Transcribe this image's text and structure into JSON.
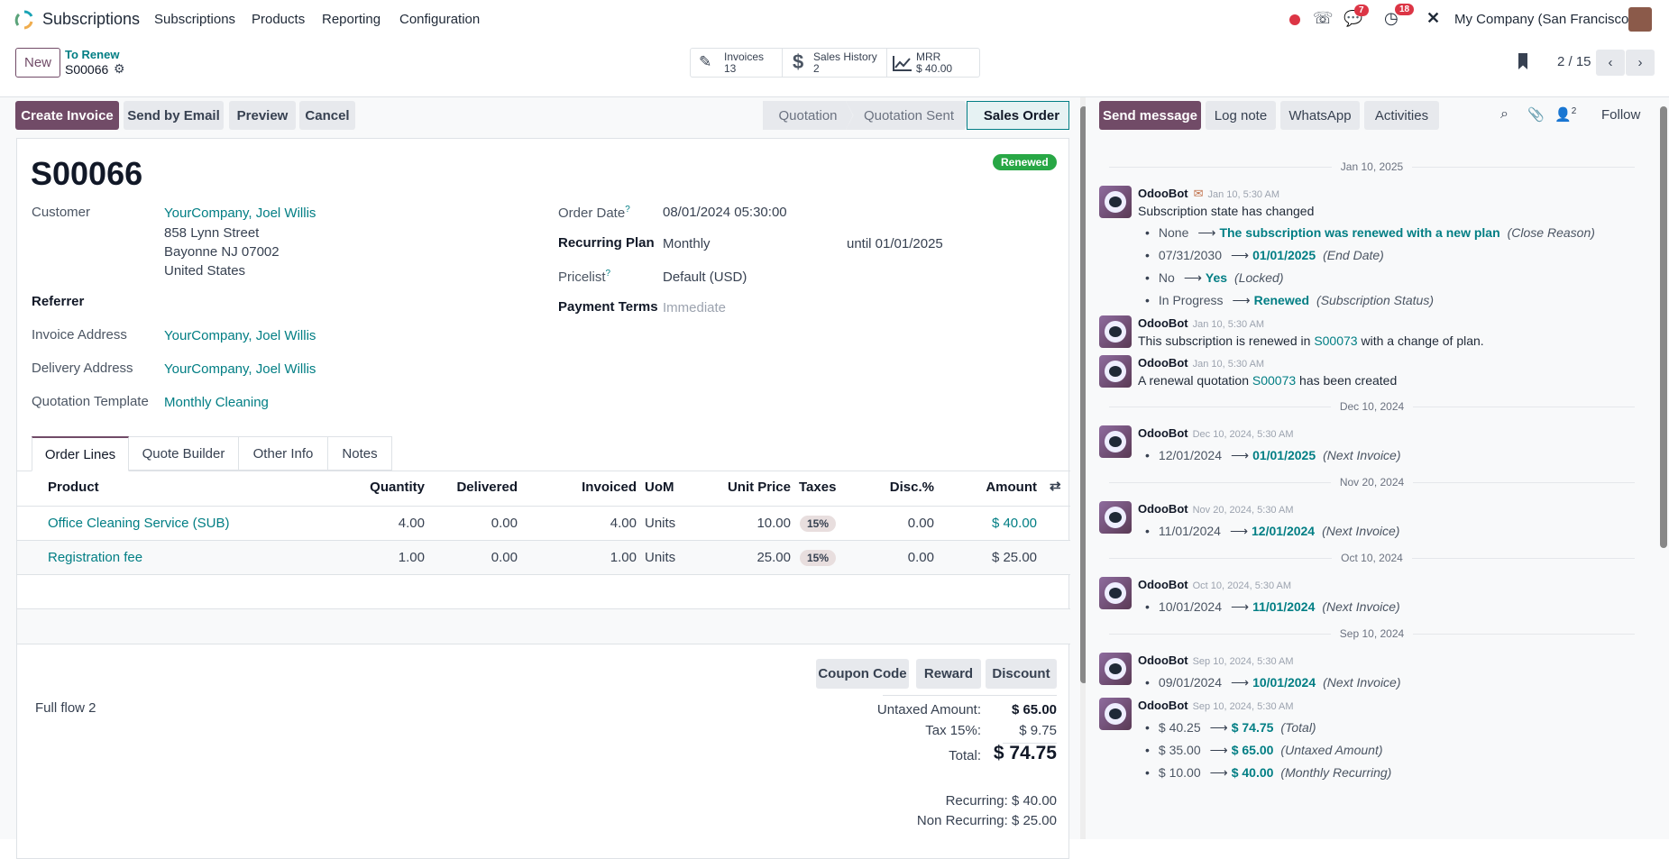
{
  "nav": {
    "app": "Subscriptions",
    "menu": [
      "Subscriptions",
      "Products",
      "Reporting",
      "Configuration"
    ],
    "chat_count": "7",
    "activity_count": "18",
    "company": "My Company (San Francisco)"
  },
  "control": {
    "new": "New",
    "breadcrumb": "To Renew",
    "record": "S00066",
    "stats": [
      {
        "label": "Invoices",
        "value": "13"
      },
      {
        "label": "Sales History",
        "value": "2"
      },
      {
        "label": "MRR",
        "value": "$ 40.00"
      }
    ],
    "pager": "2 / 15"
  },
  "actions": {
    "create_invoice": "Create Invoice",
    "send_email": "Send by Email",
    "preview": "Preview",
    "cancel": "Cancel"
  },
  "statusbar": {
    "stages": [
      "Quotation",
      "Quotation Sent",
      "Sales Order"
    ],
    "active": "Sales Order"
  },
  "form": {
    "name": "S00066",
    "ribbon": "Renewed",
    "customer_label": "Customer",
    "customer": "YourCompany, Joel Willis",
    "address": [
      "858 Lynn Street",
      "Bayonne NJ 07002",
      "United States"
    ],
    "referrer_label": "Referrer",
    "invoice_address_label": "Invoice Address",
    "invoice_address": "YourCompany, Joel Willis",
    "delivery_address_label": "Delivery Address",
    "delivery_address": "YourCompany, Joel Willis",
    "template_label": "Quotation Template",
    "template": "Monthly Cleaning",
    "order_date_label": "Order Date",
    "order_date": "08/01/2024 05:30:00",
    "help": "?",
    "plan_label": "Recurring Plan",
    "plan": "Monthly",
    "until": "until 01/01/2025",
    "pricelist_label": "Pricelist",
    "pricelist": "Default (USD)",
    "terms_label": "Payment Terms",
    "terms": "Immediate"
  },
  "tabs": [
    "Order Lines",
    "Quote Builder",
    "Other Info",
    "Notes"
  ],
  "table": {
    "headers": [
      "Product",
      "Quantity",
      "Delivered",
      "Invoiced",
      "UoM",
      "Unit Price",
      "Taxes",
      "Disc.%",
      "Amount"
    ],
    "rows": [
      [
        "Office Cleaning Service (SUB)",
        "4.00",
        "0.00",
        "4.00",
        "Units",
        "10.00",
        "15%",
        "0.00",
        "$ 40.00"
      ],
      [
        "Registration fee",
        "1.00",
        "0.00",
        "1.00",
        "Units",
        "25.00",
        "15%",
        "0.00",
        "$ 25.00"
      ]
    ]
  },
  "promo": [
    "Coupon Code",
    "Reward",
    "Discount"
  ],
  "note": "Full flow 2",
  "totals": {
    "untaxed_label": "Untaxed Amount:",
    "untaxed": "$ 65.00",
    "tax_label": "Tax 15%:",
    "tax": "$ 9.75",
    "total_label": "Total:",
    "total": "$ 74.75",
    "recurring": "Recurring: $ 40.00",
    "non_recurring": "Non Recurring: $ 25.00"
  },
  "chatter": {
    "buttons": [
      "Send message",
      "Log note",
      "WhatsApp",
      "Activities"
    ],
    "followers": "2",
    "follow": "Follow",
    "items": [
      {
        "type": "date",
        "label": "Jan 10, 2025"
      },
      {
        "type": "msg",
        "author": "OdooBot",
        "email": true,
        "date": "Jan 10, 5:30 AM",
        "body": "Subscription state has changed",
        "changes": [
          {
            "old": "None",
            "new": "The subscription was renewed with a new plan",
            "field": "(Close Reason)"
          },
          {
            "old": "07/31/2030",
            "new": "01/01/2025",
            "field": "(End Date)"
          },
          {
            "old": "No",
            "new": "Yes",
            "field": "(Locked)"
          },
          {
            "old": "In Progress",
            "new": "Renewed",
            "field": "(Subscription Status)"
          }
        ]
      },
      {
        "type": "msg",
        "author": "OdooBot",
        "date": "Jan 10, 5:30 AM",
        "body_pre": "This subscription is renewed in ",
        "link": "S00073",
        "body_post": " with a change of plan."
      },
      {
        "type": "msg",
        "author": "OdooBot",
        "date": "Jan 10, 5:30 AM",
        "body_pre": "A renewal quotation ",
        "link": "S00073",
        "body_post": " has been created"
      },
      {
        "type": "date",
        "label": "Dec 10, 2024"
      },
      {
        "type": "msg",
        "author": "OdooBot",
        "date": "Dec 10, 2024, 5:30 AM",
        "changes": [
          {
            "old": "12/01/2024",
            "new": "01/01/2025",
            "field": "(Next Invoice)"
          }
        ]
      },
      {
        "type": "date",
        "label": "Nov 20, 2024"
      },
      {
        "type": "msg",
        "author": "OdooBot",
        "date": "Nov 20, 2024, 5:30 AM",
        "changes": [
          {
            "old": "11/01/2024",
            "new": "12/01/2024",
            "field": "(Next Invoice)"
          }
        ]
      },
      {
        "type": "date",
        "label": "Oct 10, 2024"
      },
      {
        "type": "msg",
        "author": "OdooBot",
        "date": "Oct 10, 2024, 5:30 AM",
        "changes": [
          {
            "old": "10/01/2024",
            "new": "11/01/2024",
            "field": "(Next Invoice)"
          }
        ]
      },
      {
        "type": "date",
        "label": "Sep 10, 2024"
      },
      {
        "type": "msg",
        "author": "OdooBot",
        "date": "Sep 10, 2024, 5:30 AM",
        "changes": [
          {
            "old": "09/01/2024",
            "new": "10/01/2024",
            "field": "(Next Invoice)"
          }
        ]
      },
      {
        "type": "msg",
        "author": "OdooBot",
        "date": "Sep 10, 2024, 5:30 AM",
        "changes": [
          {
            "old": "$ 40.25",
            "new": "$ 74.75",
            "field": "(Total)"
          },
          {
            "old": "$ 35.00",
            "new": "$ 65.00",
            "field": "(Untaxed Amount)"
          },
          {
            "old": "$ 10.00",
            "new": "$ 40.00",
            "field": "(Monthly Recurring)"
          }
        ]
      }
    ]
  },
  "colors": {
    "primary": "#714b67",
    "link": "#017e84",
    "success": "#28a745",
    "danger": "#dc3545"
  }
}
